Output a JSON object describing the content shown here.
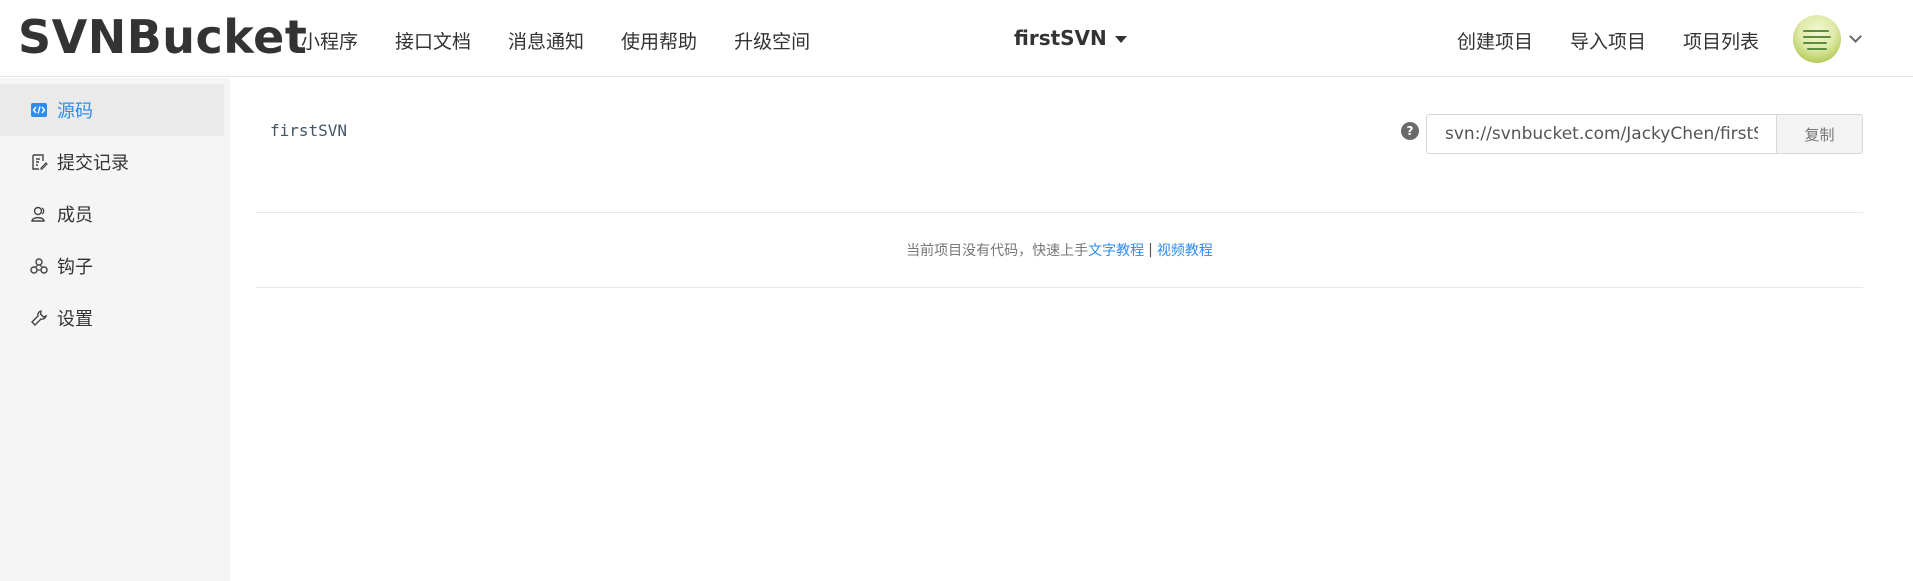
{
  "header": {
    "logo": "SVNBucket",
    "nav": [
      "小程序",
      "接口文档",
      "消息通知",
      "使用帮助",
      "升级空间"
    ],
    "project_name": "firstSVN",
    "right_nav": [
      "创建项目",
      "导入项目",
      "项目列表"
    ]
  },
  "sidebar": {
    "items": [
      {
        "label": "源码",
        "icon": "code-icon"
      },
      {
        "label": "提交记录",
        "icon": "commit-log-icon"
      },
      {
        "label": "成员",
        "icon": "members-icon"
      },
      {
        "label": "钩子",
        "icon": "hook-icon"
      },
      {
        "label": "设置",
        "icon": "settings-wrench-icon"
      }
    ]
  },
  "main": {
    "repo_name": "firstSVN",
    "help_glyph": "?",
    "repo_url": "svn://svnbucket.com/JackyChen/firstSVN",
    "copy_label": "复制",
    "empty_text": "当前项目没有代码，快速上手",
    "text_tutorial": "文字教程",
    "separator": "|",
    "video_tutorial": "视频教程"
  },
  "colors": {
    "accent": "#2d8cf0",
    "sidebar_bg": "#f5f5f5",
    "sidebar_active_bg": "#eaeaea"
  }
}
